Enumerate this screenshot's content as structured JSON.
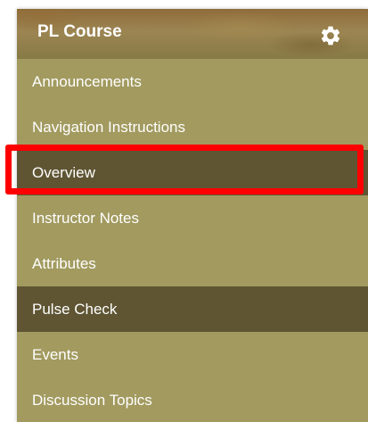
{
  "header": {
    "title": "PL Course",
    "settings_icon": "gear-icon"
  },
  "menu": {
    "items": [
      {
        "label": "Announcements",
        "active": false
      },
      {
        "label": "Navigation Instructions",
        "active": false
      },
      {
        "label": "Overview",
        "active": true
      },
      {
        "label": "Instructor Notes",
        "active": false
      },
      {
        "label": "Attributes",
        "active": false
      },
      {
        "label": "Pulse Check",
        "active": true
      },
      {
        "label": "Events",
        "active": false
      },
      {
        "label": "Discussion Topics",
        "active": false
      }
    ]
  },
  "colors": {
    "menu_background": "#a29a5f",
    "active_item_background": "#5f5533",
    "text": "#ffffff",
    "highlight_border": "#ff0000"
  }
}
